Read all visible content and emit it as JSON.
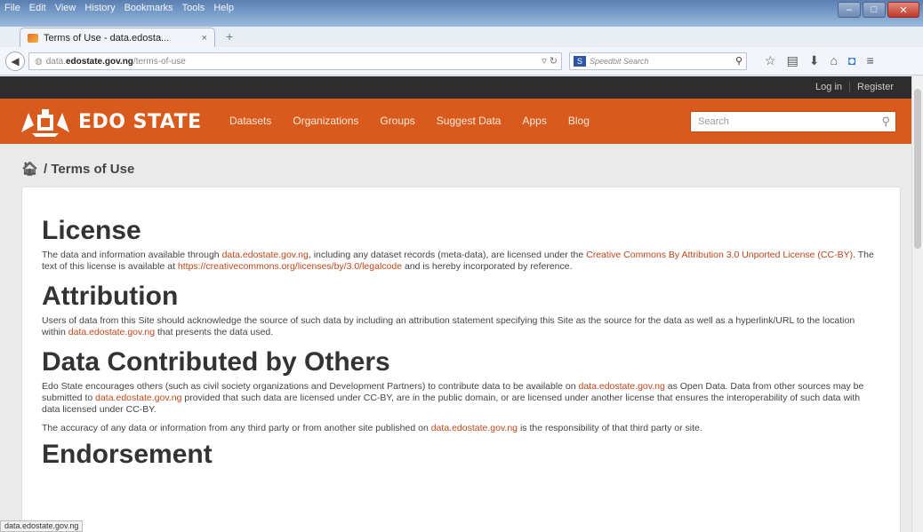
{
  "menu": [
    "File",
    "Edit",
    "View",
    "History",
    "Bookmarks",
    "Tools",
    "Help"
  ],
  "window_controls": {
    "minimize": "–",
    "maximize": "□",
    "close": "✕"
  },
  "tab": {
    "title": "Terms of Use - data.edosta...",
    "close": "×",
    "new_tab": "+"
  },
  "url": {
    "prefix": "data.",
    "domain": "edostate.gov.ng",
    "path": "/terms-of-use"
  },
  "browser_search": {
    "engine": "S",
    "placeholder": "Speedbit Search"
  },
  "site": {
    "account_links": [
      "Log in",
      "Register"
    ],
    "logo_text": "EDO STATE",
    "nav": [
      "Datasets",
      "Organizations",
      "Groups",
      "Suggest Data",
      "Apps",
      "Blog"
    ],
    "search_placeholder": "Search",
    "breadcrumb": "/ Terms of Use"
  },
  "content": {
    "license_heading": "License",
    "license_p": {
      "t1": "The data and information available through ",
      "l1": "data.edostate.gov.ng",
      "t2": ", including any dataset records (meta-data), are licensed under the ",
      "l2": "Creative Commons By Attribution 3.0 Unported License (CC-BY)",
      "t3": ". The text of this license is available at ",
      "l3": "https://creativecommons.org/licenses/by/3.0/legalcode",
      "t4": " and is hereby incorporated by reference."
    },
    "attribution_heading": "Attribution",
    "attribution_p": {
      "t1": "Users of data from this Site should acknowledge the source of such data by including an attribution statement specifying this Site as the source for the data as well as a hyperlink/URL to the location within ",
      "l1": "data.edostate.gov.ng",
      "t2": " that presents the data used."
    },
    "contrib_heading": "Data Contributed by Others",
    "contrib_p1": {
      "t1": "Edo State encourages others (such as civil society organizations and Development Partners) to contribute data to be available on ",
      "l1": "data.edostate.gov.ng",
      "t2": " as Open Data.  Data from other sources may be submitted to ",
      "l2": "data.edostate.gov.ng",
      "t3": " provided that such data are licensed under CC-BY, are in the public domain, or are licensed under another license that ensures the interoperability of such data with data licensed under CC-BY."
    },
    "contrib_p2": {
      "t1": "The accuracy of any data or information from any third party or from another site published on ",
      "l1": "data.edostate.gov.ng",
      "t2": " is the responsibility of that third party or site."
    },
    "partial_heading": "Endorsement"
  },
  "status_text": "data.edostate.gov.ng"
}
